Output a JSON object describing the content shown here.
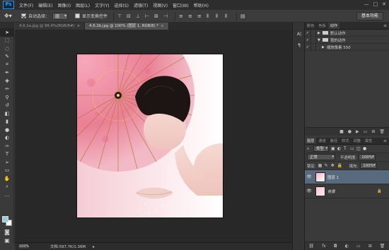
{
  "app": {
    "logo": "Ps"
  },
  "menu": [
    "文件(F)",
    "编辑(E)",
    "图像(I)",
    "图层(L)",
    "文字(Y)",
    "选择(S)",
    "滤镜(T)",
    "视图(V)",
    "窗口(W)",
    "帮助(H)"
  ],
  "window_controls": [
    "—",
    "□",
    "✕"
  ],
  "options": {
    "auto_select_label": "自动选择：",
    "auto_select_value": "组",
    "show_transform_label": "显示变换控件",
    "workspace": "基本功能"
  },
  "tabs": [
    {
      "label": "4.6.2a.jpg @ 98.4%(RGB/8#)",
      "close": "×",
      "active": false
    },
    {
      "label": "4.6.2b.jpg @ 100% (图层 1, RGB/8) *",
      "close": "×",
      "active": true
    }
  ],
  "status": {
    "zoom": "100%",
    "doc": "文档:597.7K/1.36M",
    "arrow": "▸"
  },
  "actions_panel": {
    "tabs": [
      "颜色",
      "色板",
      "动作"
    ],
    "active_tab": "动作",
    "rows": [
      {
        "label": "默认动作",
        "type": "folder",
        "expanded": false
      },
      {
        "label": "我的动作",
        "type": "folder",
        "expanded": true
      },
      {
        "label": "缩放像素 550",
        "type": "action",
        "expanded": false
      }
    ]
  },
  "layers_panel": {
    "tabs": [
      "图层",
      "通道",
      "路径",
      "样式",
      "调整",
      "属性"
    ],
    "active_tab": "图层",
    "kind": "类型",
    "blend_mode": "正常",
    "opacity_label": "不透明度:",
    "opacity": "100%",
    "lock_label": "锁定:",
    "fill_label": "填充:",
    "fill": "100%",
    "layers": [
      {
        "name": "图层 1",
        "selected": true,
        "locked": false
      },
      {
        "name": "背景",
        "selected": false,
        "locked": true
      }
    ]
  },
  "colors": {
    "selection": "#5a6a7e",
    "accent": "#49a6ff",
    "foreground_swatch": "#9cc8de",
    "background_swatch": "#ffffff"
  }
}
